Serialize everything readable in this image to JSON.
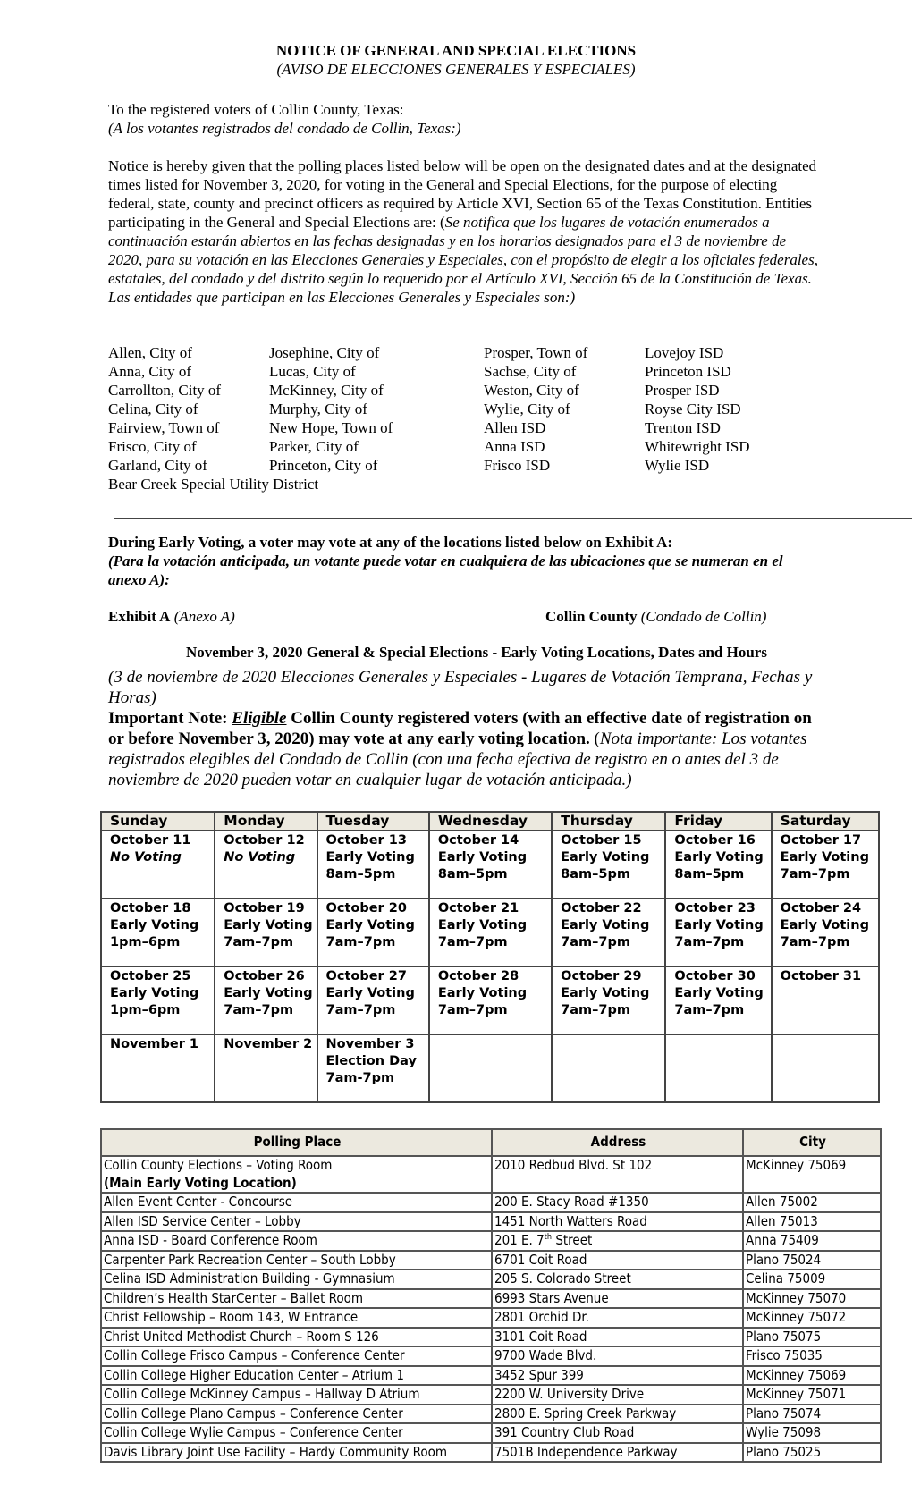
{
  "header": {
    "title": "NOTICE OF GENERAL AND SPECIAL ELECTIONS",
    "title_es": "(AVISO DE ELECCIONES GENERALES Y ESPECIALES)"
  },
  "salutation": {
    "en": "To the registered voters of Collin County, Texas:",
    "es": "(A los votantes registrados del condado de Collin, Texas:)"
  },
  "notice": {
    "en": "Notice is hereby given that the polling places listed below will be open on the designated dates and at the designated times listed for November 3, 2020, for voting in the General and Special Elections, for the purpose of electing federal, state, county and precinct officers as required by Article XVI, Section 65 of the Texas Constitution.  Entities participating in the General and Special Elections are: (",
    "es": "Se notifica que los lugares de votación enumerados a continuación estarán abiertos en las fechas designadas y en los horarios designados para el 3 de noviembre de 2020, para su votación en las Elecciones Generales y Especiales, con el propósito de elegir a los oficiales federales, estatales, del condado y del distrito según lo requerido por el Artículo XVI, Sección 65 de la Constitución de Texas.  Las entidades que participan en las Elecciones Generales y Especiales son:)"
  },
  "entities": {
    "col1": [
      "Allen, City of",
      "Anna, City of",
      "Carrollton, City of",
      "Celina, City of",
      "Fairview, Town of",
      "Frisco, City of",
      "Garland, City of",
      "Bear Creek Special Utility District"
    ],
    "col2": [
      "Josephine, City of",
      "Lucas, City of",
      "McKinney, City of",
      "Murphy, City of",
      "New Hope, Town of",
      "Parker, City of",
      "Princeton, City of"
    ],
    "col3": [
      "Prosper, Town of",
      "Sachse, City of",
      "Weston, City of",
      "Wylie, City of",
      "Allen ISD",
      "Anna ISD",
      "Frisco ISD"
    ],
    "col4": [
      "Lovejoy ISD",
      "Princeton ISD",
      "Prosper ISD",
      "Royse City ISD",
      "Trenton ISD",
      "Whitewright ISD",
      "Wylie ISD"
    ]
  },
  "early_voting": {
    "en": "During Early Voting, a voter may vote at any of the locations listed below on Exhibit A:",
    "es": "(Para la votación anticipada, un votante puede votar en cualquiera de las ubicaciones que se numeran en el anexo A):"
  },
  "exhibit": {
    "label": "Exhibit A",
    "label_es": "(Anexo A)",
    "county": "Collin County",
    "county_es": "(Condado de Collin)"
  },
  "schedule_heading": {
    "en": "November 3, 2020 General & Special Elections - Early Voting Locations, Dates and Hours",
    "es": "(3 de noviembre de 2020 Elecciones Generales y Especiales - Lugares de Votación Temprana, Fechas y Horas)"
  },
  "important_note": {
    "label": "Important Note: ",
    "eligible": "Eligible",
    "en": " Collin County registered voters (with an effective date of registration on or before November 3, 2020) may vote at any early voting location.",
    "es_open": "  (",
    "es": "Nota importante: Los votantes registrados elegibles del Condado de Collin (con una fecha efectiva de registro en o antes del 3 de noviembre de 2020 pueden votar en cualquier lugar de votación anticipada.)"
  },
  "calendar": {
    "days": [
      "Sunday",
      "Monday",
      "Tuesday",
      "Wednesday",
      "Thursday",
      "Friday",
      "Saturday"
    ],
    "weeks": [
      [
        {
          "date": "October 11",
          "status": "No Voting",
          "hours": "",
          "italic": true
        },
        {
          "date": "October 12",
          "status": "No Voting",
          "hours": "",
          "italic": true
        },
        {
          "date": "October 13",
          "status": "Early Voting",
          "hours": "8am–5pm"
        },
        {
          "date": "October 14",
          "status": "Early Voting",
          "hours": "8am–5pm"
        },
        {
          "date": "October 15",
          "status": "Early Voting",
          "hours": "8am–5pm"
        },
        {
          "date": "October 16",
          "status": "Early Voting",
          "hours": "8am–5pm"
        },
        {
          "date": "October 17",
          "status": "Early Voting",
          "hours": "7am–7pm"
        }
      ],
      [
        {
          "date": "October 18",
          "status": "Early Voting",
          "hours": "1pm–6pm"
        },
        {
          "date": "October 19",
          "status": "Early Voting",
          "hours": "7am–7pm"
        },
        {
          "date": "October 20",
          "status": "Early Voting",
          "hours": "7am–7pm"
        },
        {
          "date": "October 21",
          "status": "Early Voting",
          "hours": "7am–7pm"
        },
        {
          "date": "October 22",
          "status": "Early Voting",
          "hours": "7am–7pm"
        },
        {
          "date": "October 23",
          "status": "Early Voting",
          "hours": "7am–7pm"
        },
        {
          "date": "October 24",
          "status": "Early Voting",
          "hours": "7am–7pm"
        }
      ],
      [
        {
          "date": "October 25",
          "status": "Early Voting",
          "hours": "1pm–6pm"
        },
        {
          "date": "October 26",
          "status": "Early Voting",
          "hours": "7am–7pm"
        },
        {
          "date": "October 27",
          "status": "Early Voting",
          "hours": "7am–7pm"
        },
        {
          "date": "October 28",
          "status": "Early Voting",
          "hours": "7am–7pm"
        },
        {
          "date": "October 29",
          "status": "Early Voting",
          "hours": "7am–7pm"
        },
        {
          "date": "October 30",
          "status": "Early Voting",
          "hours": "7am–7pm"
        },
        {
          "date": "October 31",
          "status": "",
          "hours": ""
        }
      ],
      [
        {
          "date": "November 1",
          "status": "",
          "hours": ""
        },
        {
          "date": "November 2",
          "status": "",
          "hours": ""
        },
        {
          "date": "November 3",
          "status": "Election Day",
          "hours": "7am-7pm"
        },
        {
          "date": "",
          "status": "",
          "hours": ""
        },
        {
          "date": "",
          "status": "",
          "hours": ""
        },
        {
          "date": "",
          "status": "",
          "hours": ""
        },
        {
          "date": "",
          "status": "",
          "hours": ""
        }
      ]
    ]
  },
  "polling_table": {
    "headers": [
      "Polling Place",
      "Address",
      "City"
    ],
    "rows": [
      {
        "place": "Collin County Elections – Voting Room",
        "note": "(Main Early Voting Location)",
        "address": "2010 Redbud Blvd. St 102",
        "city": "McKinney 75069"
      },
      {
        "place": "Allen Event Center - Concourse",
        "address": "200 E. Stacy Road #1350",
        "city": "Allen 75002"
      },
      {
        "place": "Allen ISD Service Center – Lobby",
        "address": "1451 North Watters Road",
        "city": "Allen 75013"
      },
      {
        "place": "Anna ISD - Board Conference Room",
        "address": "201 E. 7",
        "address_sup": "th",
        "address_tail": " Street",
        "city": "Anna 75409"
      },
      {
        "place": "Carpenter Park Recreation Center – South Lobby",
        "address": "6701 Coit Road",
        "city": "Plano 75024"
      },
      {
        "place": "Celina ISD Administration Building - Gymnasium",
        "address": "205 S. Colorado Street",
        "city": "Celina 75009"
      },
      {
        "place": "Children’s Health StarCenter – Ballet Room",
        "address": "6993 Stars Avenue",
        "city": "McKinney 75070"
      },
      {
        "place": "Christ Fellowship – Room 143, W Entrance",
        "address": "2801 Orchid Dr.",
        "city": "McKinney 75072"
      },
      {
        "place": "Christ United Methodist Church – Room S 126",
        "address": "3101 Coit Road",
        "city": "Plano 75075"
      },
      {
        "place": "Collin College Frisco Campus – Conference Center",
        "address": "9700 Wade Blvd.",
        "city": "Frisco 75035"
      },
      {
        "place": "Collin College Higher Education Center – Atrium 1",
        "address": "3452 Spur 399",
        "city": "McKinney 75069"
      },
      {
        "place": "Collin College McKinney Campus – Hallway D Atrium",
        "address": "2200 W. University Drive",
        "city": "McKinney 75071"
      },
      {
        "place": "Collin College Plano Campus – Conference Center",
        "address": "2800 E. Spring Creek Parkway",
        "city": "Plano 75074"
      },
      {
        "place": "Collin College Wylie Campus – Conference Center",
        "address": "391 Country Club Road",
        "city": "Wylie 75098"
      },
      {
        "place": "Davis Library Joint Use Facility – Hardy Community Room",
        "address": "7501B Independence Parkway",
        "city": "Plano 75025"
      }
    ]
  }
}
